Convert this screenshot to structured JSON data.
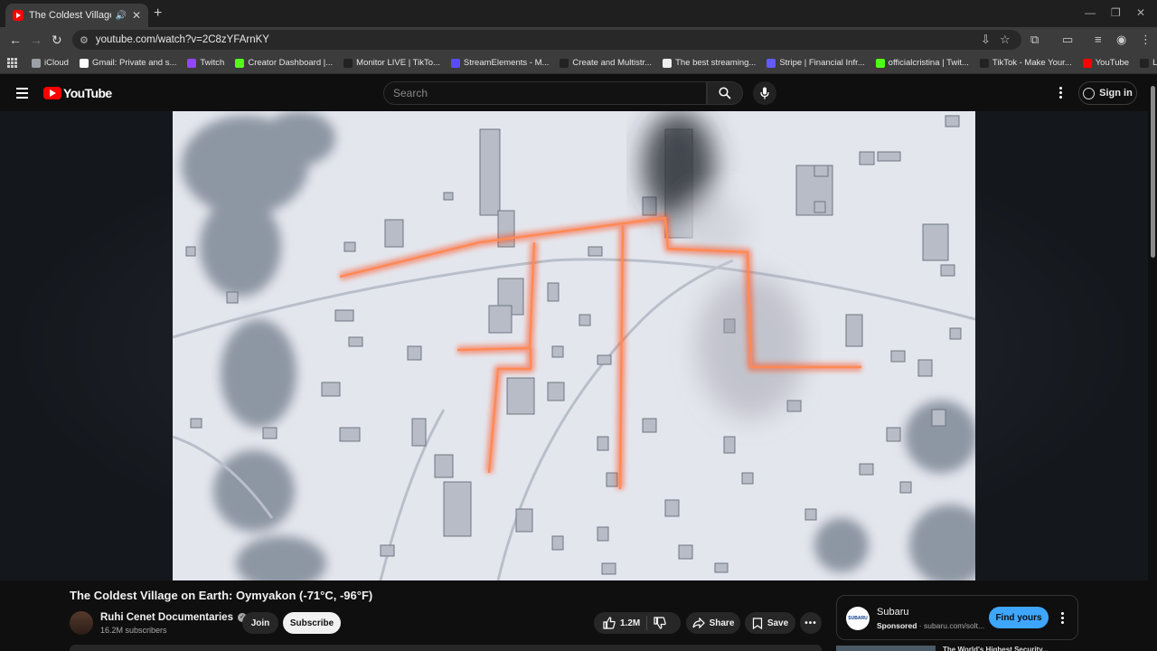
{
  "browser": {
    "tab_title": "The Coldest Village on Earth",
    "url": "youtube.com/watch?v=2C8zYFArnKY",
    "bookmarks": [
      {
        "label": "iCloud",
        "color": "#9aa0a6"
      },
      {
        "label": "Gmail: Private and s...",
        "color": "#ffffff"
      },
      {
        "label": "Twitch",
        "color": "#9146ff"
      },
      {
        "label": "Creator Dashboard |...",
        "color": "#53fc18"
      },
      {
        "label": "Monitor LIVE | TikTo...",
        "color": "#222222"
      },
      {
        "label": "StreamElements - M...",
        "color": "#5b4bff"
      },
      {
        "label": "Create and Multistr...",
        "color": "#222222"
      },
      {
        "label": "The best streaming...",
        "color": "#eeeeee"
      },
      {
        "label": "Stripe | Financial Infr...",
        "color": "#635bff"
      },
      {
        "label": "officialcristina | Twit...",
        "color": "#53fc18"
      },
      {
        "label": "TikTok - Make Your...",
        "color": "#222222"
      },
      {
        "label": "YouTube",
        "color": "#ff0000"
      },
      {
        "label": "LIVE Center",
        "color": "#222222"
      }
    ]
  },
  "masthead": {
    "logo": "YouTube",
    "search_placeholder": "Search",
    "signin": "Sign in"
  },
  "video": {
    "title": "The Coldest Village on Earth: Oymyakon (-71°C, -96°F)",
    "channel": "Ruhi Cenet Documentaries",
    "subscribers": "16.2M subscribers",
    "join": "Join",
    "subscribe": "Subscribe",
    "likes": "1.2M",
    "share": "Share",
    "save": "Save"
  },
  "ad": {
    "brand": "Subaru",
    "logo_text": "SUBARU",
    "sponsored": "Sponsored",
    "domain": "· subaru.com/solt...",
    "cta": "Find yours"
  },
  "up_next": {
    "title": "The World's Highest Security..."
  },
  "colors": {
    "accent_red": "#ff0000",
    "cta_blue": "#3ea6ff",
    "pipe_glow": "#ff5a1f"
  }
}
